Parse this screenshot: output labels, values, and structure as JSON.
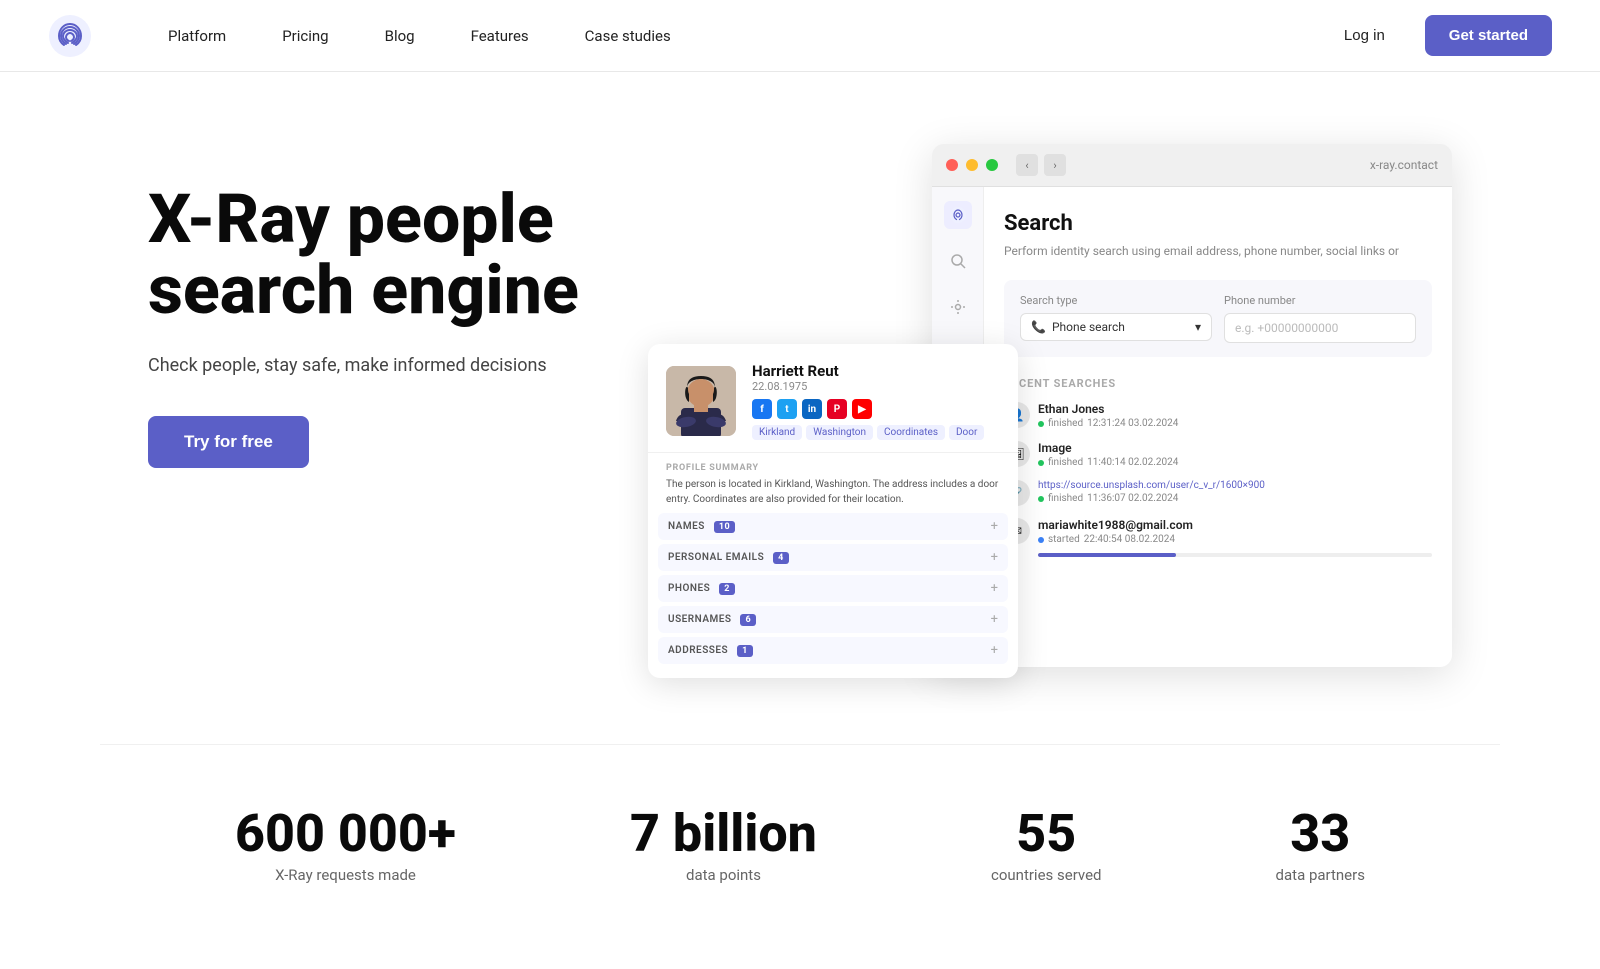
{
  "nav": {
    "logo_alt": "X-Ray logo",
    "links": [
      {
        "label": "Platform",
        "id": "platform"
      },
      {
        "label": "Pricing",
        "id": "pricing"
      },
      {
        "label": "Blog",
        "id": "blog"
      },
      {
        "label": "Features",
        "id": "features"
      },
      {
        "label": "Case studies",
        "id": "case-studies"
      }
    ],
    "login_label": "Log in",
    "get_started_label": "Get started"
  },
  "hero": {
    "title": "X-Ray people search engine",
    "subtitle": "Check people, stay safe, make informed decisions",
    "cta_label": "Try for free"
  },
  "mockup": {
    "url": "x-ray.contact",
    "search_title": "Search",
    "search_desc": "Perform identity search using email address, phone number, social links or",
    "search_type_label": "Search type",
    "phone_number_label": "Phone number",
    "search_type_value": "Phone search",
    "phone_placeholder": "e.g. +00000000000",
    "recent_searches_title": "RECENT SEARCHES",
    "recent_items": [
      {
        "icon": "👤",
        "name": "Ethan Jones",
        "status": "finished",
        "time": "12:31:24 03.02.2024"
      },
      {
        "icon": "🖼",
        "name": "Image",
        "status": "finished",
        "time": "11:40:14 02.02.2024"
      },
      {
        "icon": "🔗",
        "name": "https://source.unsplash.com/user/c_v_r/1600×900",
        "status": "finished",
        "time": "11:36:07 02.02.2024"
      },
      {
        "icon": "✉",
        "name": "mariawhite1988@gmail.com",
        "status": "started",
        "time": "22:40:54 08.02.2024"
      }
    ]
  },
  "profile": {
    "name": "Harriett Reut",
    "dob": "22.08.1975",
    "tags": [
      "Kirkland",
      "Washington",
      "Coordinates",
      "Door"
    ],
    "summary": "The person is located in Kirkland, Washington. The address includes a door entry. Coordinates are also provided for their location.",
    "data_rows": [
      {
        "label": "NAMES",
        "count": "10"
      },
      {
        "label": "PERSONAL EMAILS",
        "count": "4"
      },
      {
        "label": "PHONES",
        "count": "2"
      },
      {
        "label": "USERNAMES",
        "count": "6"
      },
      {
        "label": "ADDRESSES",
        "count": "1"
      }
    ]
  },
  "stats": [
    {
      "number": "600 000+",
      "label": "X-Ray requests made"
    },
    {
      "number": "7 billion",
      "label": "data points"
    },
    {
      "number": "55",
      "label": "countries served"
    },
    {
      "number": "33",
      "label": "data partners"
    }
  ]
}
